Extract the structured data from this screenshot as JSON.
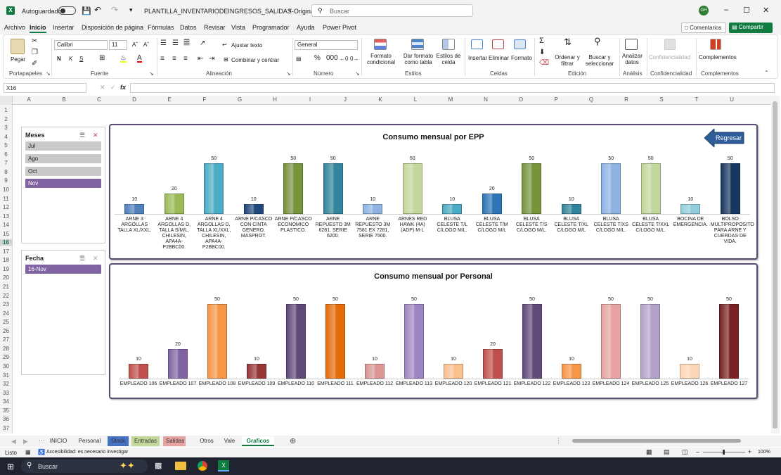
{
  "titlebar": {
    "autosave_label": "Autoguardado",
    "file_name": "PLANTILLA_INVENTARIODEINGRESOS_SALIDAS-Original.xlsm",
    "search_placeholder": "Buscar",
    "user_initials": "GH"
  },
  "ribbon_tabs": [
    "Archivo",
    "Inicio",
    "Insertar",
    "Disposición de página",
    "Fórmulas",
    "Datos",
    "Revisar",
    "Vista",
    "Programador",
    "Ayuda",
    "Power Pivot"
  ],
  "comments_label": "Comentarios",
  "share_label": "Compartir",
  "ribbon": {
    "paste": "Pegar",
    "font_name": "Calibri",
    "font_size": "11",
    "wrap_text": "Ajustar texto",
    "merge": "Combinar y centrar",
    "number_format": "General",
    "cond_format": "Formato condicional",
    "table_format": "Dar formato como tabla",
    "cell_styles": "Estilos de celda",
    "insert": "Insertar",
    "delete": "Eliminar",
    "format": "Formato",
    "sort": "Ordenar y filtrar",
    "find": "Buscar y seleccionar",
    "analyze": "Analizar datos",
    "confidential": "Confidencialidad",
    "addins": "Complementos",
    "groups": {
      "clipboard": "Portapapeles",
      "font": "Fuente",
      "alignment": "Alineación",
      "number": "Número",
      "styles": "Estilos",
      "cells": "Celdas",
      "editing": "Edición",
      "analysis": "Análisis",
      "confidentiality": "Confidencialidad",
      "complements": "Complementos"
    }
  },
  "name_box": "X16",
  "fx": "fx",
  "columns": [
    "A",
    "B",
    "C",
    "D",
    "E",
    "F",
    "G",
    "H",
    "I",
    "J",
    "K",
    "L",
    "M",
    "N",
    "O",
    "P",
    "Q",
    "R",
    "S",
    "T",
    "U"
  ],
  "rows": [
    "1",
    "2",
    "3",
    "4",
    "5",
    "6",
    "7",
    "8",
    "9",
    "10",
    "11",
    "12",
    "13",
    "14",
    "15",
    "16",
    "17",
    "18",
    "19",
    "20",
    "21",
    "22",
    "23",
    "24",
    "25",
    "26",
    "27",
    "28",
    "29",
    "30",
    "31",
    "32",
    "33",
    "34",
    "35",
    "36",
    "37"
  ],
  "selected_row": "16",
  "slicers": {
    "months": {
      "title": "Meses",
      "items": [
        {
          "label": "Jul",
          "selected": false
        },
        {
          "label": "Ago",
          "selected": false
        },
        {
          "label": "Oct",
          "selected": false
        },
        {
          "label": "Nov",
          "selected": true
        }
      ]
    },
    "date": {
      "title": "Fecha",
      "items": [
        {
          "label": "16-Nov",
          "selected": true
        }
      ]
    }
  },
  "back_button": "Regresar",
  "chart_data": [
    {
      "type": "bar",
      "title": "Consumo mensual por EPP",
      "ylim": [
        0,
        50
      ],
      "categories": [
        "ARNE 3 ARGOLLAS TALLA XL/XXL.",
        "ARNE 4 ARGOLLAS D, TALLA S/M/L, CHILESIN, APA4A-P2BBC00.",
        "ARNE 4 ARGOLLAS D, TALLA XL/XXL, CHILESIN, APA4A-P2BBC00.",
        "ARNE P/CASCO CON CINTA GENERO, MASPROT.",
        "ARNE P/CASCO ECONOMICO PLASTICO.",
        "ARNE REPUESTO 3M 6281. SERIE 6200.",
        "ARNE REPUESTO 3M 7581 EX 7281, SERIE 7500.",
        "ARNES RED HAWK (4A) (ADP) M-L",
        "BLUSA CELESTE T/L C/LOGO M/L.",
        "BLUSA CELESTE T/M C/LOGO M/L",
        "BLUSA CELESTE T/S C/LOGO M/L.",
        "BLUSA CELESTE T/XL C/LOGO M/L",
        "BLUSA CELESTE T/XS C/LOGO M/L.",
        "BLUSA CELESTE T/XXL C/LOGO M/L.",
        "BOCINA DE EMERGENCIA.",
        "BOLSO MULTIPROPOSITO PARA ARNE Y CUERDAS DE VIDA."
      ],
      "values": [
        10,
        20,
        50,
        10,
        50,
        50,
        10,
        50,
        10,
        20,
        50,
        10,
        50,
        50,
        10,
        50
      ],
      "colors": [
        "#4f81bd",
        "#9bbb59",
        "#4bacc6",
        "#1f497d",
        "#77933c",
        "#31859c",
        "#8db3e2",
        "#c3d69b",
        "#4bacc6",
        "#2e75b6",
        "#77933c",
        "#31859c",
        "#8db3e2",
        "#c3d69b",
        "#92cddc",
        "#17375e"
      ]
    },
    {
      "type": "bar",
      "title": "Consumo mensual por Personal",
      "ylim": [
        0,
        50
      ],
      "categories": [
        "EMPLEADO 106",
        "EMPLEADO 107",
        "EMPLEADO 108",
        "EMPLEADO 109",
        "EMPLEADO 110",
        "EMPLEADO 111",
        "EMPLEADO 112",
        "EMPLEADO 113",
        "EMPLEADO 120",
        "EMPLEADO 121",
        "EMPLEADO 122",
        "EMPLEADO 123",
        "EMPLEADO 124",
        "EMPLEADO 125",
        "EMPLEADO 126",
        "EMPLEADO 127"
      ],
      "values": [
        10,
        20,
        50,
        10,
        50,
        50,
        10,
        50,
        10,
        20,
        50,
        10,
        50,
        50,
        10,
        50
      ],
      "colors": [
        "#c0504d",
        "#8064a2",
        "#f79646",
        "#953735",
        "#5f497a",
        "#e46c0a",
        "#d99694",
        "#9f86c2",
        "#fac090",
        "#c0504d",
        "#604a7b",
        "#f79646",
        "#e6a3a1",
        "#b3a2c7",
        "#fcd5b4",
        "#7a2222"
      ]
    }
  ],
  "sheet_tabs": [
    {
      "label": "INICIO",
      "color": ""
    },
    {
      "label": "Personal",
      "color": ""
    },
    {
      "label": "Stock",
      "color": "#4472c4"
    },
    {
      "label": "Entradas",
      "color": "#c4d79b"
    },
    {
      "label": "Salidas",
      "color": "#e6a3a1"
    },
    {
      "label": "Otros",
      "color": ""
    },
    {
      "label": "Vale",
      "color": ""
    },
    {
      "label": "Graficos",
      "color": "active"
    }
  ],
  "status": {
    "ready": "Listo",
    "accessibility": "Accesibilidad: es necesario investigar",
    "zoom": "100%"
  },
  "taskbar": {
    "search": "Buscar"
  }
}
